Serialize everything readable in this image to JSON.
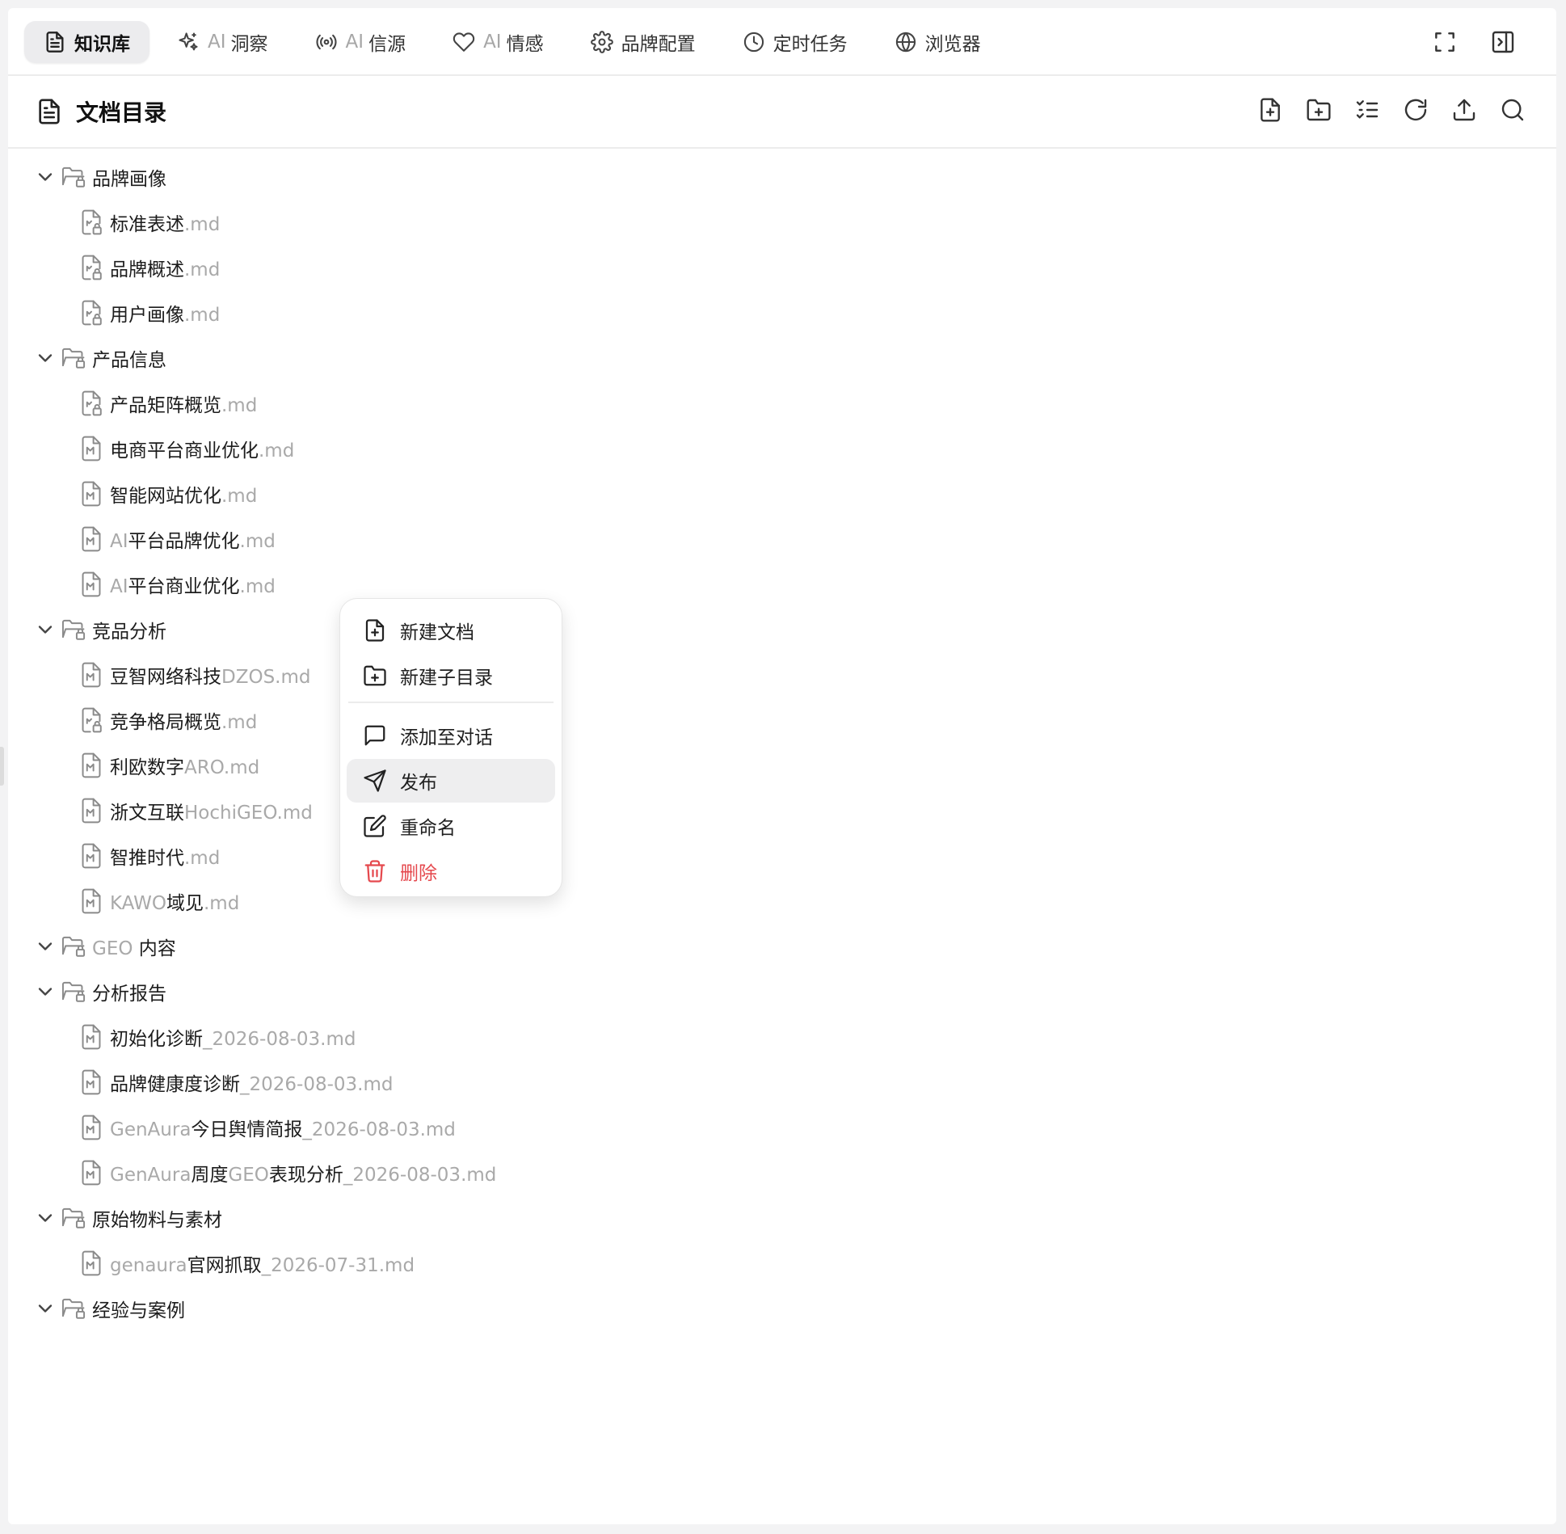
{
  "tabs": [
    {
      "prefix": "",
      "label": "知识库",
      "icon": "file-text-icon",
      "active": true
    },
    {
      "prefix": "AI",
      "label": "洞察",
      "icon": "sparkles-icon",
      "active": false
    },
    {
      "prefix": "AI",
      "label": "信源",
      "icon": "radio-icon",
      "active": false
    },
    {
      "prefix": "AI",
      "label": "情感",
      "icon": "heart-icon",
      "active": false
    },
    {
      "prefix": "",
      "label": "品牌配置",
      "icon": "gear-icon",
      "active": false
    },
    {
      "prefix": "",
      "label": "定时任务",
      "icon": "clock-icon",
      "active": false
    },
    {
      "prefix": "",
      "label": "浏览器",
      "icon": "globe-icon",
      "active": false
    }
  ],
  "section": {
    "title": "文档目录"
  },
  "tree": {
    "folders": [
      {
        "name": "品牌画像",
        "files": [
          {
            "parts": [
              {
                "t": "标准表述",
                "lat": false
              }
            ],
            "ext": ".md",
            "locked": true
          },
          {
            "parts": [
              {
                "t": "品牌概述",
                "lat": false
              }
            ],
            "ext": ".md",
            "locked": true
          },
          {
            "parts": [
              {
                "t": "用户画像",
                "lat": false
              }
            ],
            "ext": ".md",
            "locked": true
          }
        ]
      },
      {
        "name": "产品信息",
        "files": [
          {
            "parts": [
              {
                "t": "产品矩阵概览",
                "lat": false
              }
            ],
            "ext": ".md",
            "locked": true
          },
          {
            "parts": [
              {
                "t": "电商平台商业优化",
                "lat": false
              }
            ],
            "ext": ".md",
            "locked": false
          },
          {
            "parts": [
              {
                "t": "智能网站优化",
                "lat": false
              }
            ],
            "ext": ".md",
            "locked": false
          },
          {
            "parts": [
              {
                "t": "AI",
                "lat": true
              },
              {
                "t": "平台品牌优化",
                "lat": false
              }
            ],
            "ext": ".md",
            "locked": false
          },
          {
            "parts": [
              {
                "t": "AI",
                "lat": true
              },
              {
                "t": "平台商业优化",
                "lat": false
              }
            ],
            "ext": ".md",
            "locked": false
          }
        ]
      },
      {
        "name": "竞品分析",
        "files": [
          {
            "parts": [
              {
                "t": "豆智网络科技",
                "lat": false
              },
              {
                "t": "DZOS",
                "lat": true
              }
            ],
            "ext": ".md",
            "locked": false
          },
          {
            "parts": [
              {
                "t": "竞争格局概览",
                "lat": false
              }
            ],
            "ext": ".md",
            "locked": true
          },
          {
            "parts": [
              {
                "t": "利欧数字",
                "lat": false
              },
              {
                "t": "ARO",
                "lat": true
              }
            ],
            "ext": ".md",
            "locked": false
          },
          {
            "parts": [
              {
                "t": "浙文互联",
                "lat": false
              },
              {
                "t": "HochiGEO",
                "lat": true
              }
            ],
            "ext": ".md",
            "locked": false
          },
          {
            "parts": [
              {
                "t": "智推时代",
                "lat": false
              }
            ],
            "ext": ".md",
            "locked": false
          },
          {
            "parts": [
              {
                "t": "KAWO",
                "lat": true
              },
              {
                "t": "域见",
                "lat": false
              }
            ],
            "ext": ".md",
            "locked": false
          }
        ]
      },
      {
        "name_parts": [
          {
            "t": "GEO ",
            "lat": true
          },
          {
            "t": "内容",
            "lat": false
          }
        ],
        "name": "GEO 内容",
        "files": []
      },
      {
        "name": "分析报告",
        "files": [
          {
            "parts": [
              {
                "t": "初始化诊断",
                "lat": false
              },
              {
                "t": "_2026-08-03",
                "lat": true
              }
            ],
            "ext": ".md",
            "locked": false
          },
          {
            "parts": [
              {
                "t": "品牌健康度诊断",
                "lat": false
              },
              {
                "t": "_2026-08-03",
                "lat": true
              }
            ],
            "ext": ".md",
            "locked": false
          },
          {
            "parts": [
              {
                "t": "GenAura",
                "lat": true
              },
              {
                "t": "今日舆情简报",
                "lat": false
              },
              {
                "t": "_2026-08-03",
                "lat": true
              }
            ],
            "ext": ".md",
            "locked": false
          },
          {
            "parts": [
              {
                "t": "GenAura",
                "lat": true
              },
              {
                "t": "周度",
                "lat": false
              },
              {
                "t": "GEO",
                "lat": true
              },
              {
                "t": "表现分析",
                "lat": false
              },
              {
                "t": "_2026-08-03",
                "lat": true
              }
            ],
            "ext": ".md",
            "locked": false
          }
        ]
      },
      {
        "name": "原始物料与素材",
        "files": [
          {
            "parts": [
              {
                "t": "genaura",
                "lat": true
              },
              {
                "t": "官网抓取",
                "lat": false
              },
              {
                "t": "_2026-07-31",
                "lat": true
              }
            ],
            "ext": ".md",
            "locked": false
          }
        ]
      },
      {
        "name": "经验与案例",
        "files": []
      }
    ]
  },
  "context_menu": {
    "items": [
      {
        "label": "新建文档",
        "icon": "file-plus-icon",
        "style": "normal"
      },
      {
        "label": "新建子目录",
        "icon": "folder-plus-icon",
        "style": "normal"
      },
      {
        "label": "添加至对话",
        "icon": "message-square-icon",
        "style": "normal"
      },
      {
        "label": "发布",
        "icon": "send-icon",
        "style": "highlighted"
      },
      {
        "label": "重命名",
        "icon": "edit-icon",
        "style": "normal"
      },
      {
        "label": "删除",
        "icon": "trash-icon",
        "style": "danger"
      }
    ]
  },
  "colors": {
    "danger": "#e5484d",
    "muted_text": "#a9a9a9",
    "hover_bg": "#eeeeef"
  }
}
